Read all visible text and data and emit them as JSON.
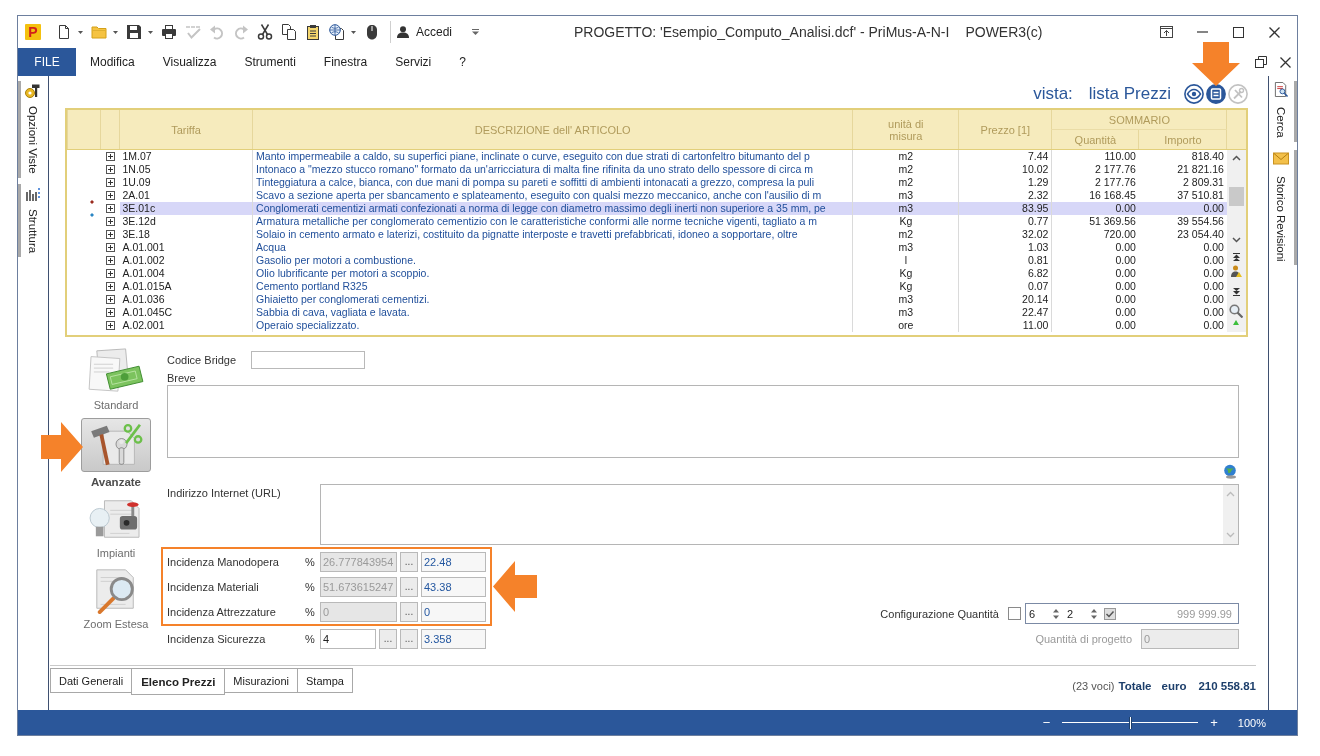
{
  "app": {
    "logo": "P"
  },
  "window": {
    "title": "PROGETTO: 'Esempio_Computo_Analisi.dcf' - PriMus-A-N-I",
    "edition": "POWER3(c)"
  },
  "quick_access": [
    {
      "kind": "new",
      "dropdown": true,
      "disabled": false
    },
    {
      "kind": "open",
      "dropdown": true,
      "disabled": false
    },
    {
      "kind": "save",
      "dropdown": true,
      "disabled": false
    },
    {
      "kind": "print",
      "dropdown": false,
      "disabled": false
    },
    {
      "kind": "spelling",
      "dropdown": false,
      "disabled": true
    },
    {
      "kind": "undo",
      "dropdown": false,
      "disabled": true
    },
    {
      "kind": "redo",
      "dropdown": false,
      "disabled": true
    },
    {
      "kind": "cut",
      "dropdown": false,
      "disabled": false
    },
    {
      "kind": "copy",
      "dropdown": false,
      "disabled": false
    },
    {
      "kind": "paste",
      "dropdown": false,
      "disabled": false
    },
    {
      "kind": "web",
      "dropdown": true,
      "disabled": false
    },
    {
      "kind": "mouse",
      "dropdown": false,
      "disabled": false
    }
  ],
  "account": {
    "label": "Accedi"
  },
  "menu": {
    "file": "FILE",
    "items": [
      "Modifica",
      "Visualizza",
      "Strumenti",
      "Finestra",
      "Servizi",
      "?"
    ]
  },
  "left_panel": {
    "tabs": [
      {
        "kind": "options",
        "label": "Opzioni Viste"
      },
      {
        "kind": "structure",
        "label": "Struttura"
      }
    ]
  },
  "right_panel": {
    "tabs": [
      {
        "kind": "search",
        "label": "Cerca"
      },
      {
        "kind": "history",
        "label": "Storico Revisioni"
      }
    ]
  },
  "view": {
    "label": "vista:",
    "name": "lista Prezzi",
    "buttons": [
      {
        "kind": "eye",
        "selected": false,
        "disabled": false,
        "callout": false
      },
      {
        "kind": "list",
        "selected": true,
        "disabled": false,
        "callout": true
      },
      {
        "kind": "tools",
        "selected": false,
        "disabled": true,
        "callout": false
      }
    ]
  },
  "table": {
    "columns": [
      "Tariffa",
      "DESCRIZIONE dell' ARTICOLO",
      "unità di misura",
      "Prezzo [1]"
    ],
    "group": {
      "label": "SOMMARIO",
      "columns": [
        "Quantità",
        "Importo"
      ]
    },
    "rows": [
      {
        "code": "1M.07",
        "description": "Manto impermeabile a caldo, su superfici piane, inclinate o curve, eseguito con due strati di cartonfeltro bitumanto del p",
        "unit": "m2",
        "price": "7.44",
        "quantity": "110.00",
        "amount": "818.40",
        "selected": false,
        "expanded": false
      },
      {
        "code": "1N.05",
        "description": "Intonaco a \"mezzo stucco romano\" formato da un'arricciatura di malta fine rifinita da uno strato dello spessore di circa m",
        "unit": "m2",
        "price": "10.02",
        "quantity": "2 177.76",
        "amount": "21 821.16",
        "selected": false,
        "expanded": false
      },
      {
        "code": "1U.09",
        "description": "Tinteggiatura a calce, bianca, con due mani di pompa su pareti e soffitti di ambienti intonacati a grezzo, compresa la puli",
        "unit": "m2",
        "price": "1.29",
        "quantity": "2 177.76",
        "amount": "2 809.31",
        "selected": false,
        "expanded": false
      },
      {
        "code": "2A.01",
        "description": "Scavo a sezione aperta per sbancamento e splateamento, eseguito con qualsi mezzo meccanico, anche con l'ausilio di m",
        "unit": "m3",
        "price": "2.32",
        "quantity": "16 168.45",
        "amount": "37 510.81",
        "selected": false,
        "expanded": false,
        "marker": {
          "color": "#9a2b1e"
        }
      },
      {
        "code": "3E.01c",
        "description": "Conglomerati cementizi armati confezionati a norma di legge con diametro massimo degli inerti non superiore a 35 mm, pe",
        "unit": "m3",
        "price": "83.95",
        "quantity": "0.00",
        "amount": "0.00",
        "selected": true,
        "expanded": false,
        "marker": {
          "color": "#2a86c4"
        }
      },
      {
        "code": "3E.12d",
        "description": "Armatura metalliche per conglomerato cementizio con le caratteristiche conformi alle norme tecniche vigenti, tagliato a m",
        "unit": "Kg",
        "price": "0.77",
        "quantity": "51 369.56",
        "amount": "39 554.56",
        "selected": false,
        "expanded": false
      },
      {
        "code": "3E.18",
        "description": "Solaio in cemento armato e laterizi, costituito da pignatte interposte e travetti prefabbricati, idoneo a sopportare, oltre",
        "unit": "m2",
        "price": "32.02",
        "quantity": "720.00",
        "amount": "23 054.40",
        "selected": false,
        "expanded": false
      },
      {
        "code": "A.01.001",
        "description": "Acqua",
        "unit": "m3",
        "price": "1.03",
        "quantity": "0.00",
        "amount": "0.00",
        "selected": false,
        "expanded": false
      },
      {
        "code": "A.01.002",
        "description": "Gasolio per motori a combustione.",
        "unit": "l",
        "price": "0.81",
        "quantity": "0.00",
        "amount": "0.00",
        "selected": false,
        "expanded": false
      },
      {
        "code": "A.01.004",
        "description": "Olio lubrificante per motori a scoppio.",
        "unit": "Kg",
        "price": "6.82",
        "quantity": "0.00",
        "amount": "0.00",
        "selected": false,
        "expanded": false
      },
      {
        "code": "A.01.015A",
        "description": "Cemento portland R325",
        "unit": "Kg",
        "price": "0.07",
        "quantity": "0.00",
        "amount": "0.00",
        "selected": false,
        "expanded": false
      },
      {
        "code": "A.01.036",
        "description": "Ghiaietto per conglomerati cementizi.",
        "unit": "m3",
        "price": "20.14",
        "quantity": "0.00",
        "amount": "0.00",
        "selected": false,
        "expanded": false
      },
      {
        "code": "A.01.045C",
        "description": "Sabbia di cava, vagliata e lavata.",
        "unit": "m3",
        "price": "22.47",
        "quantity": "0.00",
        "amount": "0.00",
        "selected": false,
        "expanded": false
      },
      {
        "code": "A.02.001",
        "description": "Operaio specializzato.",
        "unit": "ore",
        "price": "11.00",
        "quantity": "0.00",
        "amount": "0.00",
        "selected": false,
        "expanded": false
      }
    ]
  },
  "details": {
    "categories": [
      {
        "kind": "standard",
        "label": "Standard",
        "selected": false,
        "callout": false
      },
      {
        "kind": "advanced",
        "label": "Avanzate",
        "selected": true,
        "callout": true
      },
      {
        "kind": "systems",
        "label": "Impianti",
        "selected": false,
        "callout": false
      },
      {
        "kind": "zoom",
        "label": "Zoom Estesa",
        "selected": false,
        "callout": false
      }
    ],
    "bridge_code": {
      "label": "Codice Bridge"
    },
    "short_description": {
      "label": "Breve"
    },
    "url": {
      "label": "Indirizzo Internet (URL)"
    },
    "incidence": [
      {
        "label": "Incidenza Manodopera",
        "unit": "%",
        "percent": "26.777843954",
        "percent_disabled": true,
        "buttons": [
          "..."
        ],
        "amount": "22.48",
        "highlighted": true
      },
      {
        "label": "Incidenza Materiali",
        "unit": "%",
        "percent": "51.673615247",
        "percent_disabled": true,
        "buttons": [
          "..."
        ],
        "amount": "43.38",
        "highlighted": true
      },
      {
        "label": "Incidenza Attrezzature",
        "unit": "%",
        "percent": "0",
        "percent_disabled": true,
        "buttons": [
          "..."
        ],
        "amount": "0",
        "highlighted": true
      },
      {
        "label": "Incidenza Sicurezza",
        "unit": "%",
        "percent": "4",
        "percent_disabled": false,
        "buttons": [
          "...",
          "..."
        ],
        "amount": "3.358",
        "highlighted": false
      }
    ],
    "quantity_config": {
      "label": "Configurazione Quantità",
      "checked": false,
      "spinner_values": [
        "6",
        "2"
      ],
      "inner_checked": true,
      "display_value": "999 999.99"
    },
    "project_quantity": {
      "label": "Quantità di progetto",
      "value": "0",
      "disabled": true
    }
  },
  "tabs": [
    {
      "label": "Dati Generali",
      "selected": false
    },
    {
      "label": "Elenco Prezzi",
      "selected": true
    },
    {
      "label": "Misurazioni",
      "selected": false
    },
    {
      "label": "Stampa",
      "selected": false
    }
  ],
  "totals": {
    "count": "(23 voci)",
    "label": "Totale",
    "currency": "euro",
    "value": "210 558.81"
  },
  "status_bar": {
    "zoom_out": "−",
    "zoom_in": "+",
    "zoom": {
      "level": 0.5
    },
    "zoom_label": "100%"
  }
}
